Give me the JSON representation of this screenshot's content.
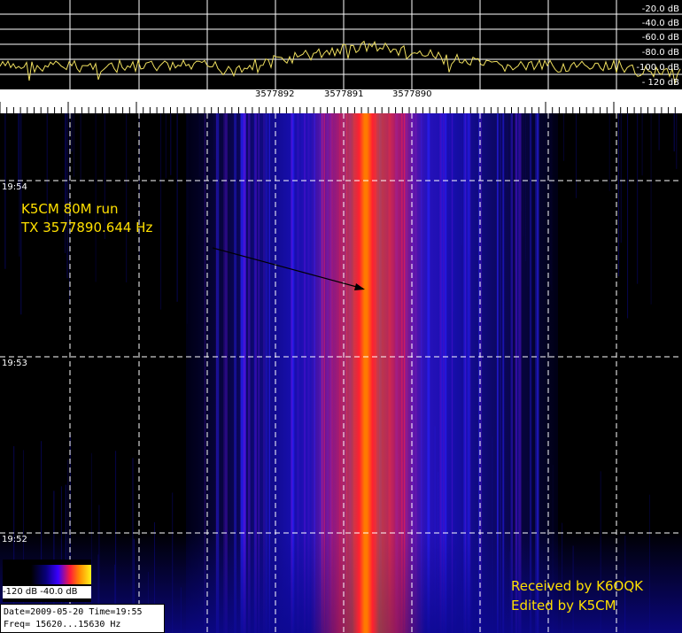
{
  "spectrum": {
    "db_labels": [
      "-20.0 dB",
      "-40.0 dB",
      "-60.0 dB",
      "-80.0 dB",
      "-100.0 dB",
      "- 120 dB"
    ]
  },
  "frequency_scale": {
    "labels": [
      "3577892",
      "3577891",
      "3577890"
    ]
  },
  "waterfall": {
    "time_labels": [
      "19:54",
      "19:53",
      "19:52"
    ],
    "annotation": {
      "line1": "K5CM 80M run",
      "line2": "TX 3577890.644 Hz"
    },
    "credits": {
      "line1": "Received by K6OQK",
      "line2": "Edited by K5CM"
    }
  },
  "legend": {
    "min_label": "-120 dB",
    "max_label": "-40.0 dB"
  },
  "info": {
    "date_time": "Date=2009-05-20 Time=19:55",
    "freq": "Freq= 15620...15630 Hz"
  },
  "colors": {
    "spectrum_trace": "#f0e060",
    "grid": "#ffffff",
    "annotation": "#ffe000",
    "signal_core": "#ff8a00",
    "noise": "#1a10d0"
  }
}
